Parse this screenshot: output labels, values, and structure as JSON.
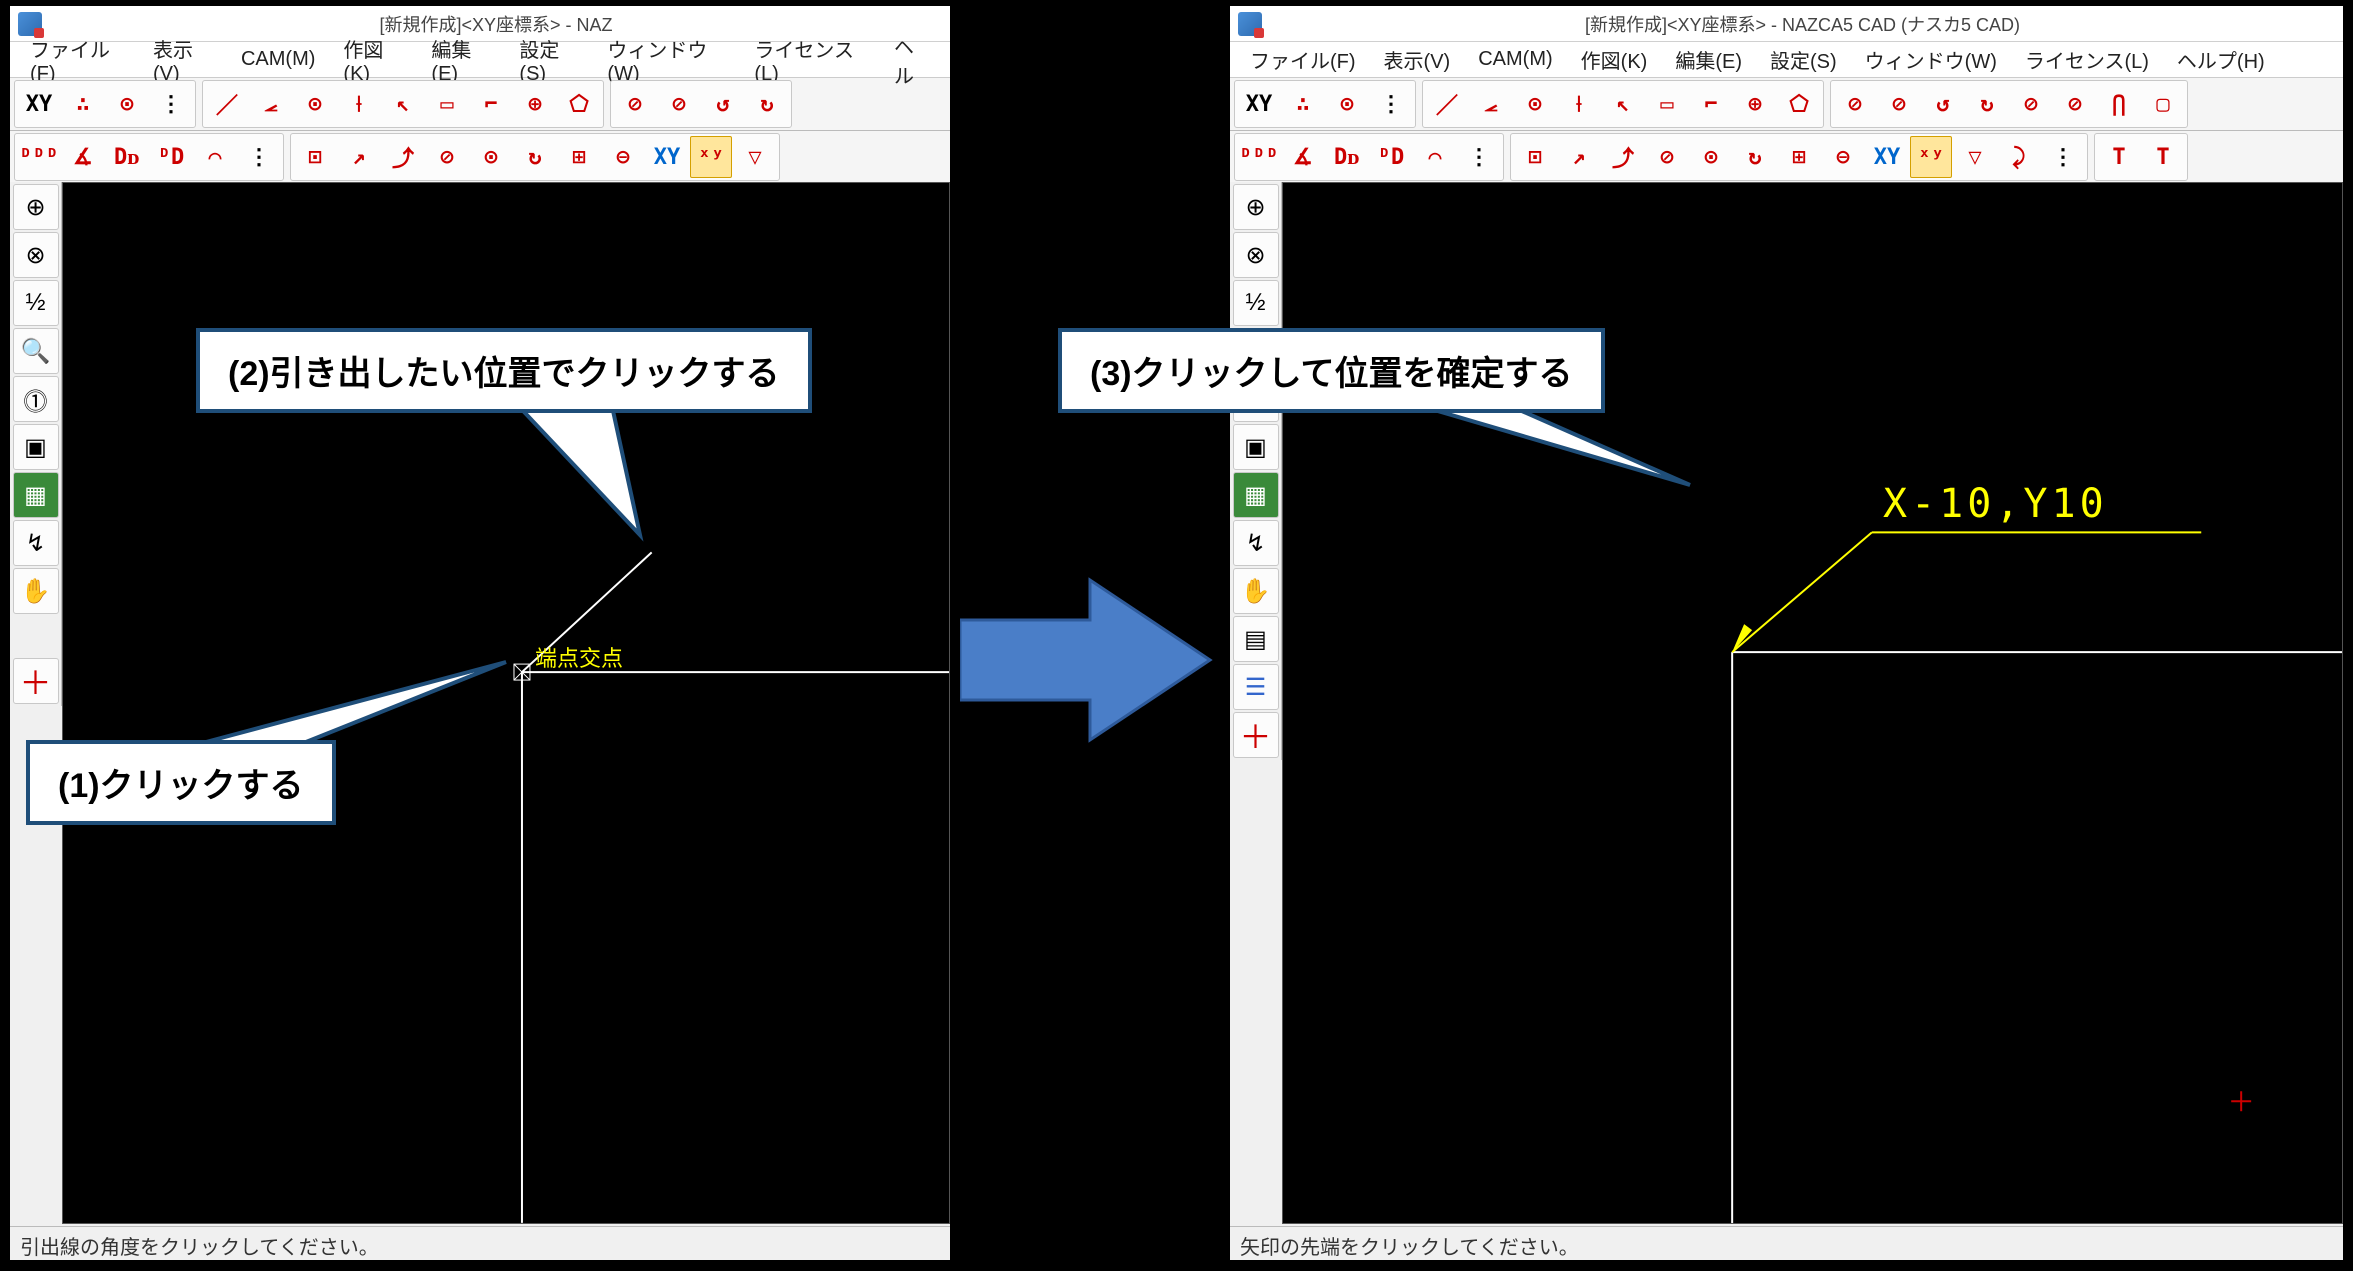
{
  "left": {
    "title": "[新規作成]<XY座標系> - NAZ",
    "menus": [
      "ファイル(F)",
      "表示(V)",
      "CAM(M)",
      "作図(K)",
      "編集(E)",
      "設定(S)",
      "ウィンドウ(W)",
      "ライセンス(L)",
      "ヘル"
    ],
    "status": "引出線の角度をクリックしてください。",
    "snap_label": "端点交点"
  },
  "right": {
    "title": "[新規作成]<XY座標系> - NAZCA5 CAD (ナスカ5 CAD)",
    "menus": [
      "ファイル(F)",
      "表示(V)",
      "CAM(M)",
      "作図(K)",
      "編集(E)",
      "設定(S)",
      "ウィンドウ(W)",
      "ライセンス(L)",
      "ヘルプ(H)"
    ],
    "status": "矢印の先端をクリックしてください。",
    "coord_label": "X-10,Y10"
  },
  "tb1": [
    "XY",
    "∴",
    "⊙",
    "⋮"
  ],
  "tb2": [
    "／",
    "⦟",
    "⊙",
    "⟊",
    "↖",
    "▭",
    "⌐",
    "⊕",
    "⬠"
  ],
  "tb3": [
    "⊘",
    "⊘",
    "↺",
    "↻",
    "⊘",
    "⊘",
    "⋂",
    "▢"
  ],
  "tb4": [
    "ᴰᴰᴰ",
    "∡",
    "Dᴅ",
    "ᴰD",
    "⌒",
    "⋮"
  ],
  "tb5": [
    "⊡",
    "↗",
    "⤴",
    "⊘",
    "⊙",
    "↻",
    "⊞",
    "⊖",
    "XY",
    "ˣʸ",
    "▽",
    "⤸",
    "⋮"
  ],
  "tb6": [
    "T",
    "T"
  ],
  "side": [
    "⊕",
    "⊗",
    "½",
    "🔍",
    "⓵",
    "▣",
    "▦",
    "↯",
    "✋",
    "▤",
    "☰",
    "＋"
  ],
  "callouts": {
    "c1": "(1)クリックする",
    "c2": "(2)引き出したい位置でクリックする",
    "c3": "(3)クリックして位置を確定する"
  }
}
